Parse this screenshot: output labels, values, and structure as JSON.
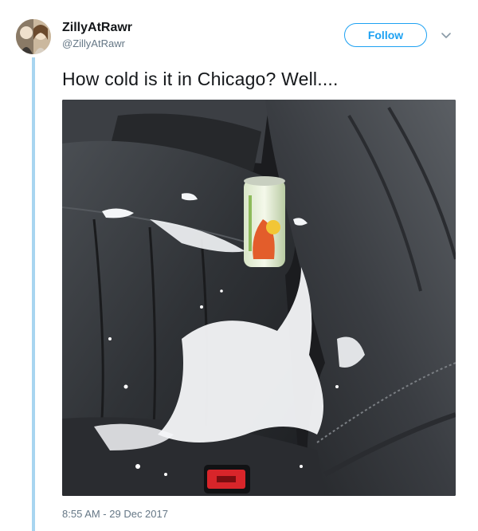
{
  "tweet": {
    "author": {
      "display_name": "ZillyAtRawr",
      "handle": "@ZillyAtRawr"
    },
    "follow_label": "Follow",
    "text": "How cold is it in Chicago? Well....",
    "timestamp": "8:55 AM - 29 Dec 2017"
  },
  "icons": {
    "menu": "chevron-down-icon"
  },
  "colors": {
    "accent": "#1da1f2",
    "thread_line": "#a8d5f0",
    "secondary_text": "#657786"
  }
}
